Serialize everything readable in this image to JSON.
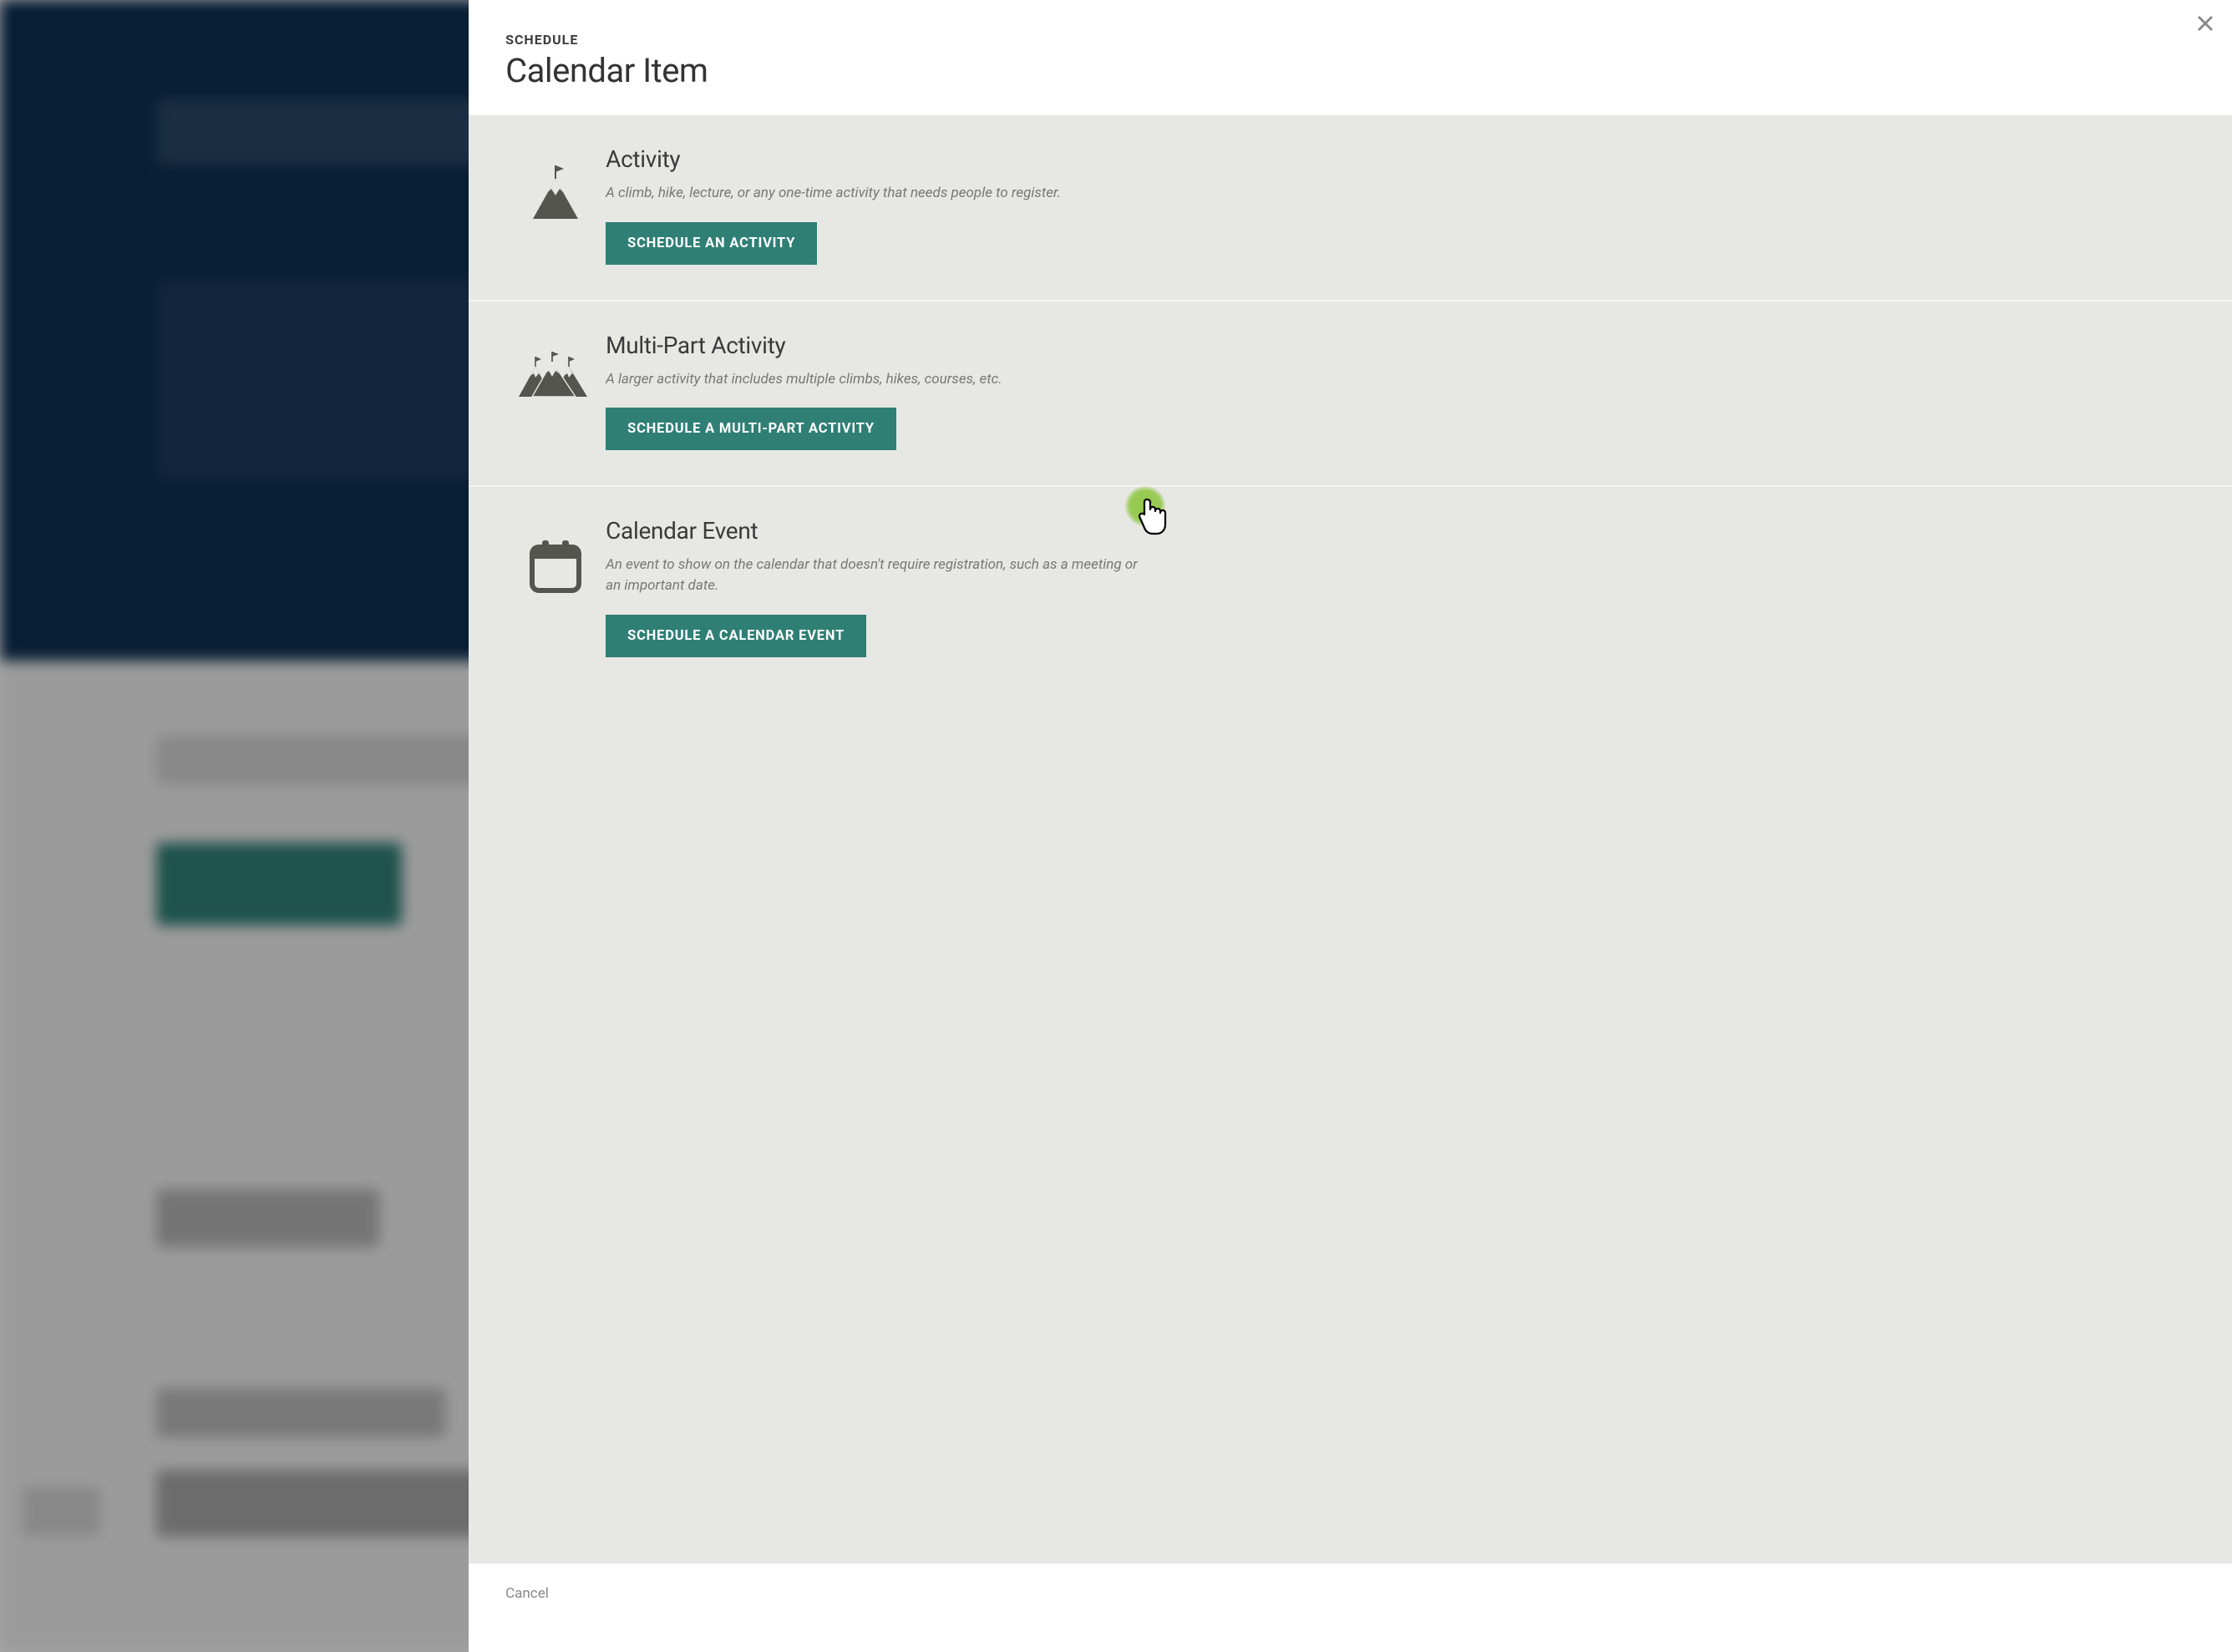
{
  "modal": {
    "breadcrumb": "SCHEDULE",
    "title": "Calendar Item",
    "close_label": "Close",
    "cancel_label": "Cancel"
  },
  "options": [
    {
      "title": "Activity",
      "description": "A climb, hike, lecture, or any one-time activity that needs people to register.",
      "button_label": "SCHEDULE AN ACTIVITY",
      "icon": "mountain-flag-icon"
    },
    {
      "title": "Multi-Part Activity",
      "description": "A larger activity that includes multiple climbs, hikes, courses, etc.",
      "button_label": "SCHEDULE A MULTI-PART ACTIVITY",
      "icon": "mountains-flags-icon"
    },
    {
      "title": "Calendar Event",
      "description": "An event to show on the calendar that doesn't require registration, such as a meeting or an important date.",
      "button_label": "SCHEDULE A CALENDAR EVENT",
      "icon": "calendar-icon"
    }
  ],
  "colors": {
    "accent": "#2f7f75",
    "backdrop_dark": "#0d2f52",
    "text_dark": "#333",
    "text_muted": "#777",
    "panel_bg": "#e7e7e4"
  }
}
